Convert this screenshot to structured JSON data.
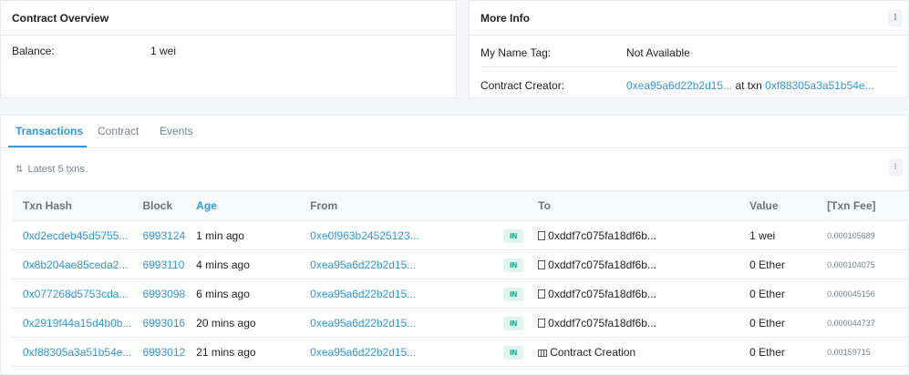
{
  "overview": {
    "title": "Contract Overview",
    "balance_label": "Balance:",
    "balance_value": "1 wei"
  },
  "moreinfo": {
    "title": "More Info",
    "menu_icon": "⁝",
    "name_tag_label": "My Name Tag:",
    "name_tag_value": "Not Available",
    "creator_label": "Contract Creator:",
    "creator_address": "0xea95a6d22b2d15...",
    "creator_at_txn": "at txn",
    "creator_txn": "0xf88305a3a51b54e..."
  },
  "tabs": {
    "transactions": "Transactions",
    "contract": "Contract",
    "events": "Events"
  },
  "latest_label": "Latest 5 txns",
  "table": {
    "headers": {
      "hash": "Txn Hash",
      "block": "Block",
      "age": "Age",
      "from": "From",
      "to": "To",
      "value": "Value",
      "fee": "[Txn Fee]"
    },
    "rows": [
      {
        "hash": "0xd2ecdeb45d5755...",
        "block": "6993124",
        "age": "1 min ago",
        "from": "0xe0f963b24525123...",
        "dir": "IN",
        "to": "0xddf7c075fa18df6b...",
        "value": "1 wei",
        "fee": "0.000105689"
      },
      {
        "hash": "0x8b204ae85ceda2...",
        "block": "6993110",
        "age": "4 mins ago",
        "from": "0xea95a6d22b2d15...",
        "dir": "IN",
        "to": "0xddf7c075fa18df6b...",
        "value": "0 Ether",
        "fee": "0.000104075"
      },
      {
        "hash": "0x077268d5753cda...",
        "block": "6993098",
        "age": "6 mins ago",
        "from": "0xea95a6d22b2d15...",
        "dir": "IN",
        "to": "0xddf7c075fa18df6b...",
        "value": "0 Ether",
        "fee": "0.000045156"
      },
      {
        "hash": "0x2919f44a15d4b0b...",
        "block": "6993016",
        "age": "20 mins ago",
        "from": "0xea95a6d22b2d15...",
        "dir": "IN",
        "to": "0xddf7c075fa18df6b...",
        "value": "0 Ether",
        "fee": "0.000044737"
      },
      {
        "hash": "0xf88305a3a51b54e...",
        "block": "6993012",
        "age": "21 mins ago",
        "from": "0xea95a6d22b2d15...",
        "dir": "IN",
        "to": "Contract Creation",
        "value": "0 Ether",
        "fee": "0.00159715"
      }
    ]
  }
}
